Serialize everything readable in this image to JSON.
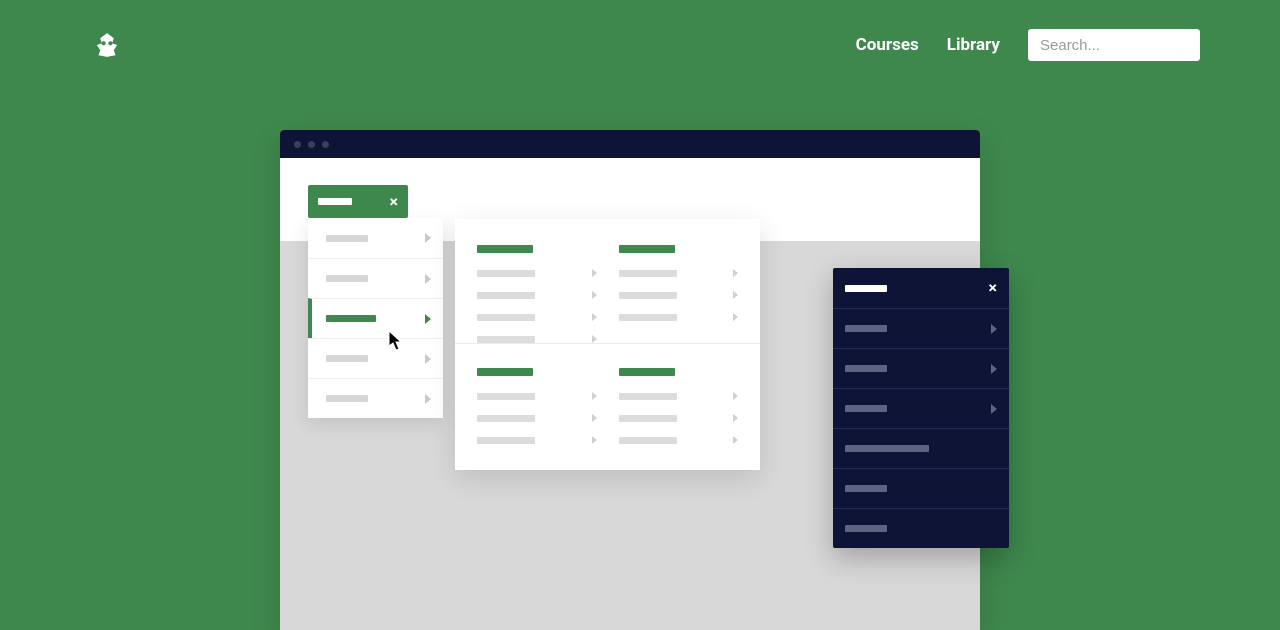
{
  "nav": {
    "links": [
      "Courses",
      "Library"
    ],
    "search_placeholder": "Search..."
  },
  "colors": {
    "brand": "#3e884d",
    "dark": "#0e1436"
  }
}
